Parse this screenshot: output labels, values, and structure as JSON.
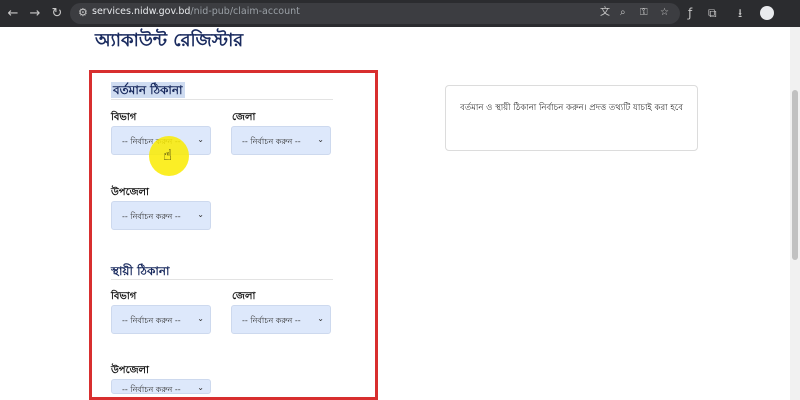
{
  "browser": {
    "url_host": "services.nidw.gov.bd",
    "url_path": "/nid-pub/claim-account",
    "icons": {
      "back": "←",
      "forward": "→",
      "reload": "↻",
      "site_info": "⚙",
      "translate": "文",
      "zoom": "⌕",
      "password_key": "⚿",
      "bookmark_star": "☆",
      "font": "ƒ",
      "extensions": "⧉",
      "download": "⭳"
    }
  },
  "page": {
    "title": "অ্যাকাউন্ট রেজিস্টার"
  },
  "present_address": {
    "title": "বর্তমান ঠিকানা",
    "division_label": "বিভাগ",
    "division_value": "-- নির্বাচন করুন --",
    "district_label": "জেলা",
    "district_value": "-- নির্বাচন করুন --",
    "upazila_label": "উপজেলা",
    "upazila_value": "-- নির্বাচন করুন --"
  },
  "permanent_address": {
    "title": "স্থায়ী ঠিকানা",
    "division_label": "বিভাগ",
    "division_value": "-- নির্বাচন করুন --",
    "district_label": "জেলা",
    "district_value": "-- নির্বাচন করুন --",
    "upazila_label": "উপজেলা",
    "upazila_value": "-- নির্বাচন করুন --"
  },
  "select_chevron": "⌄",
  "info": {
    "text": "বর্তমান ও স্থায়ী ঠিকানা নির্বাচন করুন। প্রদত্ত তথ্যটি যাচাই করা হবে"
  },
  "colors": {
    "title": "#1a2b5f",
    "select_bg": "#dde8fb",
    "highlight_box": "#d82f2f",
    "cursor_highlight": "#faeb00"
  }
}
